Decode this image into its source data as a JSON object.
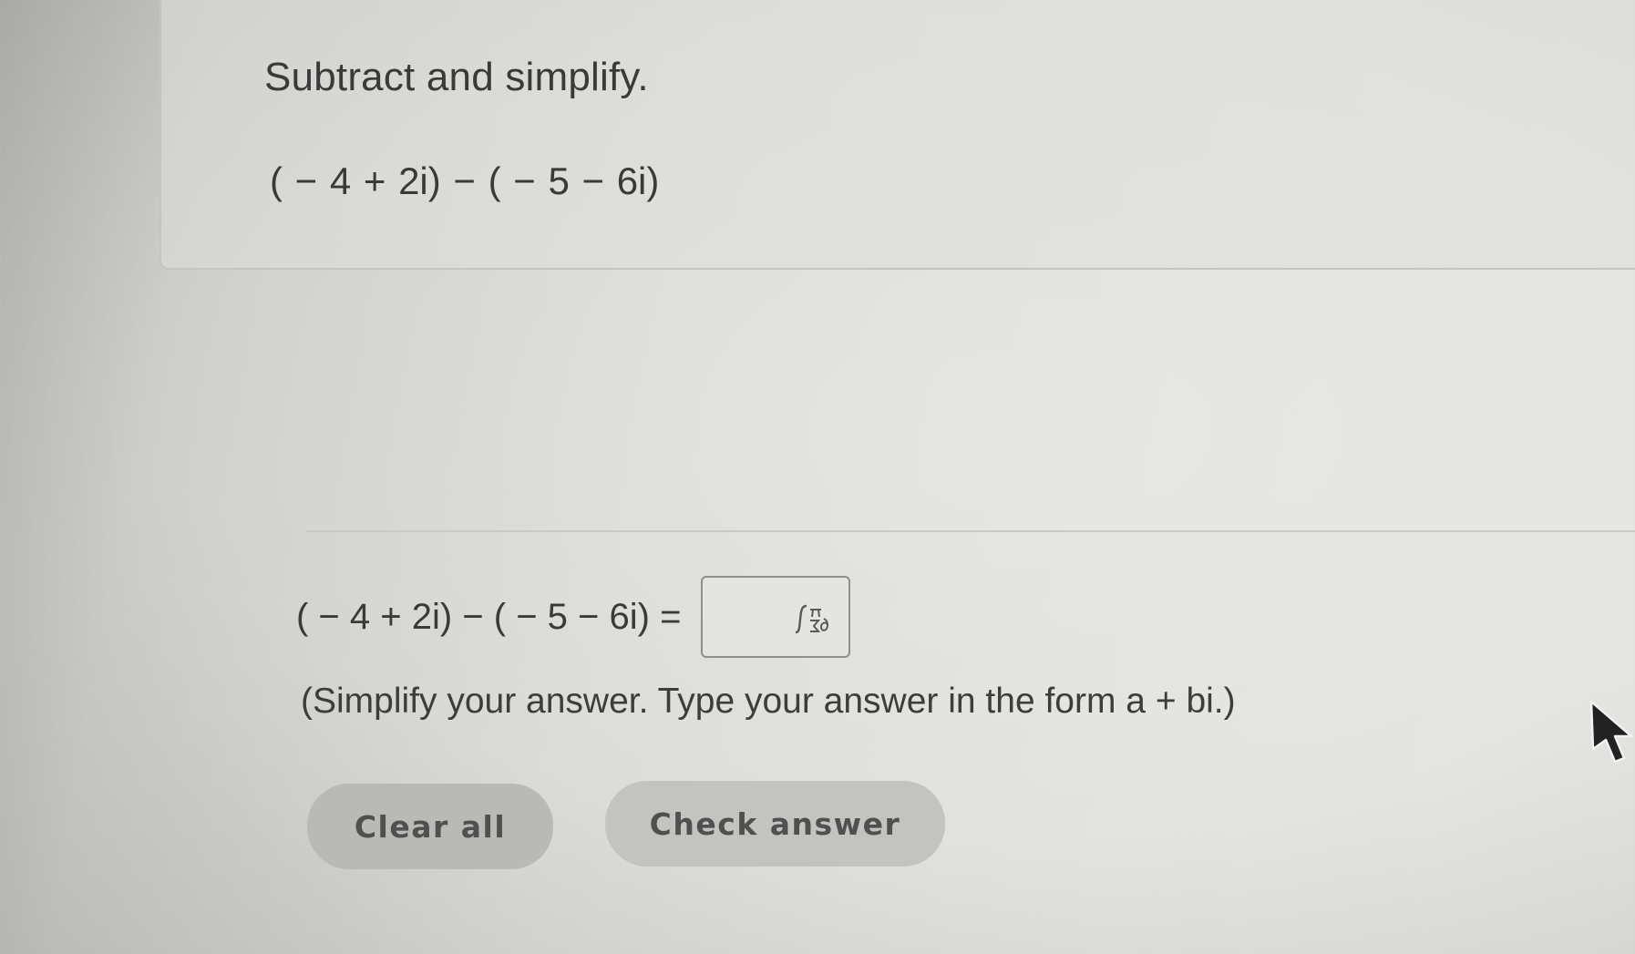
{
  "question": {
    "title": "Subtract and simplify.",
    "expression": "( − 4 + 2i) − ( − 5 − 6i)"
  },
  "answer": {
    "expression": "( − 4 + 2i) − ( − 5 − 6i) =",
    "input_value": "",
    "math_palette_icon": "math-palette-icon"
  },
  "instruction": "(Simplify your answer. Type your answer in the form a + bi.)",
  "buttons": {
    "clear_label": "Clear all",
    "check_label": "Check answer"
  },
  "cursor_icon": "mouse-pointer-icon"
}
